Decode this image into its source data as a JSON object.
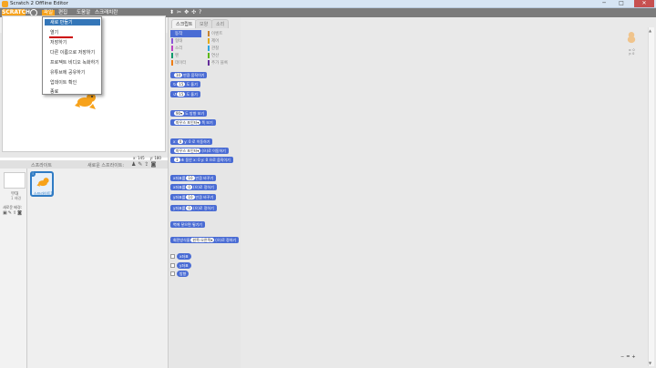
{
  "window": {
    "title": "Scratch 2 Offline Editor",
    "minimize": "─",
    "maximize": "□",
    "close": "✕"
  },
  "menubar": {
    "logo": "SCRATCH",
    "items": [
      "파일",
      "편집",
      "도움말",
      "스크래치란"
    ],
    "active_item": "파일"
  },
  "file_menu": {
    "items": [
      "새로 만들기",
      "열기",
      "저장하기",
      "다른 이름으로 저장하기",
      "프로젝트 비디오 녹화하기",
      "유튜브에 공유하기",
      "업데이트 확인",
      "종료"
    ],
    "hovered": "새로 만들기"
  },
  "stage": {
    "version": "v.460",
    "coords": {
      "x": "x: 145",
      "y": "y: 180"
    }
  },
  "sprites": {
    "title": "스프라이트",
    "new_sprite_label": "새로운 스프라이트:",
    "stage_label": "무대",
    "backdrop_count": "1 배경",
    "new_backdrop_label": "새로운 배경:",
    "selected_sprite": {
      "name": "스프라이트1",
      "info": "i"
    }
  },
  "blocks_tabs": [
    "스크립트",
    "모양",
    "소리"
  ],
  "categories": [
    {
      "label": "동작",
      "color": "#4a6cd4"
    },
    {
      "label": "형태",
      "color": "#8a55d7"
    },
    {
      "label": "소리",
      "color": "#bb42c3"
    },
    {
      "label": "펜",
      "color": "#0e9a6c"
    },
    {
      "label": "데이터",
      "color": "#ee7d16"
    },
    {
      "label": "이벤트",
      "color": "#c88330"
    },
    {
      "label": "제어",
      "color": "#e1a91a"
    },
    {
      "label": "관찰",
      "color": "#2ca5e2"
    },
    {
      "label": "연산",
      "color": "#5cb712"
    },
    {
      "label": "추가 블록",
      "color": "#632d99"
    }
  ],
  "blocks": [
    {
      "pre": "",
      "slot": "10",
      "post": "만큼 움직이기"
    },
    {
      "pre": "↻",
      "slot": "15",
      "post": "도 돌기"
    },
    {
      "pre": "↺",
      "slot": "15",
      "post": "도 돌기"
    },
    {
      "pre": "",
      "slot": "90▾",
      "post": "도 방향 보기"
    },
    {
      "pre": "",
      "slot": "마우스 포인터▾",
      "post": "쪽 보기"
    },
    {
      "pre": "x:",
      "slot": "0",
      "post": "y: 0 로 이동하기"
    },
    {
      "pre": "",
      "slot": "마우스 포인터▾",
      "post": "(으)로 이동하기"
    },
    {
      "pre": "",
      "slot": "1",
      "post": "초 동안 x: 0 y: 0 으로 움직이기"
    },
    {
      "pre": "x좌표를",
      "slot": "10",
      "post": "만큼 바꾸기"
    },
    {
      "pre": "x좌표를",
      "slot": "0",
      "post": "(으)로 정하기"
    },
    {
      "pre": "y좌표를",
      "slot": "10",
      "post": "만큼 바꾸기"
    },
    {
      "pre": "y좌표를",
      "slot": "0",
      "post": "(으)로 정하기"
    },
    {
      "pre": "벽에 닿으면 튕기기",
      "slot": "",
      "post": ""
    },
    {
      "pre": "회전방식을",
      "slot": "왼쪽-오른쪽▾",
      "post": "(으)로 정하기"
    }
  ],
  "reporters": [
    "x좌표",
    "y좌표",
    "방향"
  ],
  "script_area": {
    "sprite_x": "x: 0",
    "sprite_y": "y: 0",
    "zoom": [
      "−",
      "=",
      "+"
    ]
  },
  "colors": {
    "menubar": "#7b7b7b",
    "accent": "#f7a21b",
    "motion": "#4a6cd4",
    "selection": "#2f7bc4"
  }
}
